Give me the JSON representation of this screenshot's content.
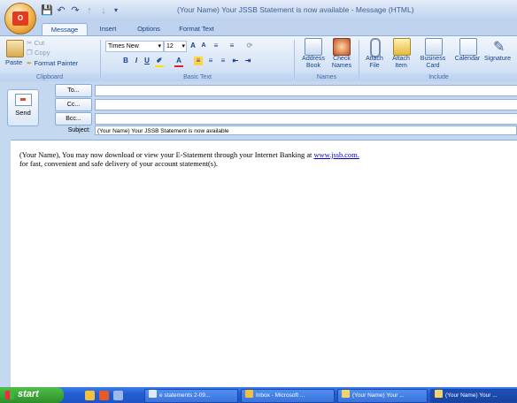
{
  "window": {
    "title": "(Your Name) Your JSSB Statement is now available - Message (HTML)"
  },
  "tabs": [
    "Message",
    "Insert",
    "Options",
    "Format Text"
  ],
  "ribbon": {
    "clipboard": {
      "label": "Clipboard",
      "paste": "Paste",
      "cut": "Cut",
      "copy": "Copy",
      "format_painter": "Format Painter"
    },
    "basic_text": {
      "label": "Basic Text",
      "font_name": "Times New",
      "font_size": "12"
    },
    "names": {
      "label": "Names",
      "address_book": "Address Book",
      "check_names": "Check Names"
    },
    "include": {
      "label": "Include",
      "attach_file": "Attach File",
      "attach_item": "Attach Item",
      "business_card": "Business Card",
      "calendar": "Calendar",
      "signature": "Signature"
    }
  },
  "compose": {
    "send": "Send",
    "to": "To...",
    "cc": "Cc...",
    "bcc": "Bcc...",
    "subject_label": "Subject:",
    "subject_value": "(Your Name) Your JSSB Statement is now available",
    "body_line1": "(Your Name), You may now download or view your E-Statement through your Internet Banking at",
    "body_link": "www.jssb.com.",
    "body_line2": "for fast, convenient and safe delivery of your account statement(s)."
  },
  "taskbar": {
    "start": "start",
    "tasks": [
      "e statements 2-09...",
      "Inbox - Microsoft ...",
      "(Your Name) Your ...",
      "(Your Name) Your ..."
    ]
  },
  "colors": {
    "ribbon_bg": "#d4e3f6",
    "taskbar": "#245ed4",
    "start_green": "#2c8f28",
    "link": "#0000cc"
  }
}
